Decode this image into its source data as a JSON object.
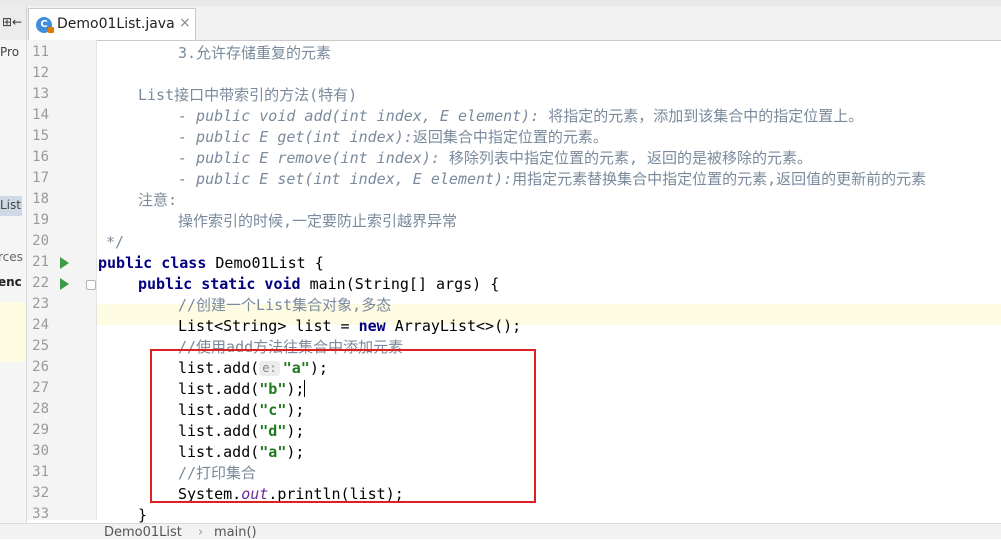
{
  "editor": {
    "tab": {
      "file_icon": "C",
      "title": "Demo01List.java",
      "close": "×"
    },
    "project_panel": {
      "top_icon_label": "⊞←",
      "items": [
        "Pro",
        "List",
        "rces",
        "enc"
      ]
    },
    "lines": [
      {
        "n": "11",
        "text": "3.允许存储重复的元素"
      },
      {
        "n": "12",
        "text": ""
      },
      {
        "n": "13",
        "text": "List接口中带索引的方法(特有)"
      },
      {
        "n": "14",
        "prefix": "- public void add(int index, E element):",
        "text": " 将指定的元素，添加到该集合中的指定位置上。"
      },
      {
        "n": "15",
        "prefix": "- public E get(int index):",
        "text": "返回集合中指定位置的元素。"
      },
      {
        "n": "16",
        "prefix": "- public E remove(int index):",
        "text": " 移除列表中指定位置的元素, 返回的是被移除的元素。"
      },
      {
        "n": "17",
        "prefix": "- public E set(int index, E element):",
        "text": "用指定元素替换集合中指定位置的元素,返回值的更新前的元素"
      },
      {
        "n": "18",
        "text": "注意:"
      },
      {
        "n": "19",
        "text": "操作索引的时候,一定要防止索引越界异常"
      },
      {
        "n": "20",
        "text": "*/"
      },
      {
        "n": "21",
        "kw": "public class",
        "text": " Demo01List {"
      },
      {
        "n": "22",
        "kw": "public static void",
        "text": " main(String[] args) {"
      },
      {
        "n": "23",
        "text": "//创建一个List集合对象,多态"
      },
      {
        "n": "24",
        "pre": "List<String> list = ",
        "kw": "new",
        "text": " ArrayList<>();"
      },
      {
        "n": "25",
        "text": "//使用add方法往集合中添加元素"
      },
      {
        "n": "26",
        "pre": "list.add(",
        "hint": "e:",
        "str": "\"a\"",
        "post": ");"
      },
      {
        "n": "27",
        "pre": "list.add(",
        "str": "\"b\"",
        "post": ");"
      },
      {
        "n": "28",
        "pre": "list.add(",
        "str": "\"c\"",
        "post": ");"
      },
      {
        "n": "29",
        "pre": "list.add(",
        "str": "\"d\"",
        "post": ");"
      },
      {
        "n": "30",
        "pre": "list.add(",
        "str": "\"a\"",
        "post": ");"
      },
      {
        "n": "31",
        "text": "//打印集合"
      },
      {
        "n": "32",
        "pre": "System.",
        "field": "out",
        "post": ".println(list);"
      },
      {
        "n": "33",
        "text": "}"
      }
    ],
    "breadcrumb": {
      "items": [
        "Demo01List",
        "main()"
      ],
      "sep": "›"
    }
  },
  "colors": {
    "annotation_box": "#e02020",
    "keyword": "#000080",
    "string": "#1e7a1e",
    "comment": "#7a8a9c",
    "run_gutter_icon": "#3d9a46"
  }
}
